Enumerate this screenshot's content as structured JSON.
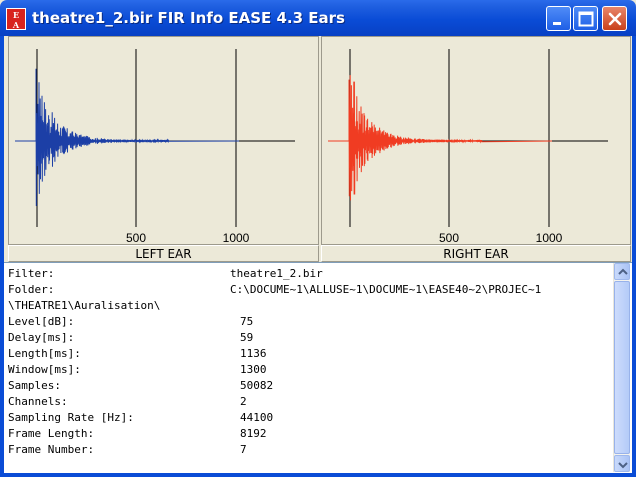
{
  "window": {
    "title": "theatre1_2.bir FIR Info EASE 4.3 Ears",
    "icon_text": "EASE",
    "accent_color": "#0a4cd6"
  },
  "title_buttons": {
    "minimize_icon": "minimize-icon",
    "maximize_icon": "maximize-icon",
    "close_icon": "close-icon"
  },
  "left_plot": {
    "label": "LEFT EAR",
    "tick_labels": [
      "500",
      "1000"
    ],
    "trace_color": "#1c3fa6"
  },
  "right_plot": {
    "label": "RIGHT EAR",
    "tick_labels": [
      "500",
      "1000"
    ],
    "trace_color": "#f03c22"
  },
  "info": {
    "filter_key": "Filter:",
    "filter_value": "theatre1_2.bir",
    "folder_key": "Folder:",
    "folder_value": "C:\\DOCUME~1\\ALLUSE~1\\DOCUME~1\\EASE40~2\\PROJEC~1",
    "folder_cont": "\\THEATRE1\\Auralisation\\",
    "rows": [
      {
        "key": "Level[dB]:",
        "value": "75"
      },
      {
        "key": "Delay[ms]:",
        "value": "59"
      },
      {
        "key": "Length[ms]:",
        "value": "1136"
      },
      {
        "key": "Window[ms]:",
        "value": "1300"
      },
      {
        "key": "Samples:",
        "value": "50082"
      },
      {
        "key": "Channels:",
        "value": "2"
      },
      {
        "key": "Sampling Rate [Hz]:",
        "value": "44100"
      },
      {
        "key": "Frame Length:",
        "value": "8192"
      },
      {
        "key": "Frame Number:",
        "value": "7"
      }
    ]
  }
}
